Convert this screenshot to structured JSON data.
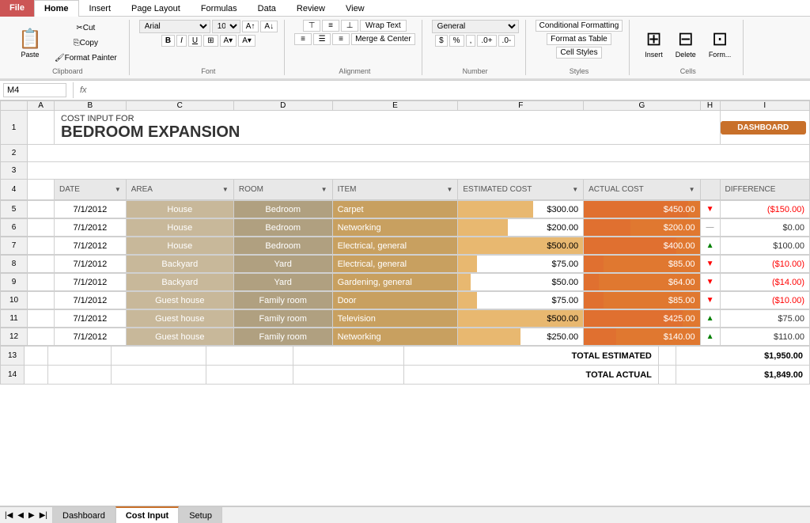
{
  "ribbon": {
    "file_label": "File",
    "tabs": [
      "Home",
      "Insert",
      "Page Layout",
      "Formulas",
      "Data",
      "Review",
      "View"
    ],
    "active_tab": "Home",
    "clipboard": {
      "paste_label": "Paste",
      "cut_label": "Cut",
      "copy_label": "Copy",
      "format_label": "Format Painter",
      "group_label": "Clipboard"
    },
    "font": {
      "name": "Arial",
      "size": "10",
      "group_label": "Font"
    },
    "alignment": {
      "wrap_text": "Wrap Text",
      "merge_center": "Merge & Center",
      "group_label": "Alignment"
    },
    "number": {
      "format": "General",
      "dollar": "$",
      "percent": "%",
      "comma": ",",
      "group_label": "Number"
    },
    "styles": {
      "conditional": "Conditional Formatting",
      "format_table": "Format as Table",
      "cell_styles": "Cell Styles",
      "group_label": "Styles"
    },
    "cells": {
      "insert": "Insert",
      "delete": "Delete",
      "format": "Form...",
      "group_label": "Cells"
    }
  },
  "formula_bar": {
    "name_box": "M4",
    "fx": "fx",
    "content": ""
  },
  "spreadsheet": {
    "col_headers": [
      "A",
      "B",
      "C",
      "D",
      "E",
      "F",
      "G",
      "H",
      "I"
    ],
    "row_headers": [
      "1",
      "2",
      "3",
      "4",
      "5",
      "6",
      "7",
      "8",
      "9",
      "10",
      "11",
      "12",
      "13",
      "14"
    ],
    "title_line1": "COST INPUT FOR",
    "title_line2": "BEDROOM EXPANSION",
    "dashboard_btn": "DASHBOARD",
    "col_headers_data": {
      "date": "DATE",
      "area": "AREA",
      "room": "ROOM",
      "item": "ITEM",
      "estimated_cost": "ESTIMATED COST",
      "actual_cost": "ACTUAL COST",
      "difference": "DIFFERENCE"
    },
    "rows": [
      {
        "date": "7/1/2012",
        "area": "House",
        "room": "Bedroom",
        "item": "Carpet",
        "estimated_cost": "$300.00",
        "est_pct": 60,
        "actual_cost": "$450.00",
        "actual_pct": 90,
        "arrow": "down",
        "difference": "($150.00)",
        "diff_type": "negative"
      },
      {
        "date": "7/1/2012",
        "area": "House",
        "room": "Bedroom",
        "item": "Networking",
        "estimated_cost": "$200.00",
        "est_pct": 40,
        "actual_cost": "$200.00",
        "actual_pct": 40,
        "arrow": "eq",
        "difference": "$0.00",
        "diff_type": "positive"
      },
      {
        "date": "7/1/2012",
        "area": "House",
        "room": "Bedroom",
        "item": "Electrical, general",
        "estimated_cost": "$500.00",
        "est_pct": 100,
        "actual_cost": "$400.00",
        "actual_pct": 80,
        "arrow": "up",
        "difference": "$100.00",
        "diff_type": "positive"
      },
      {
        "date": "7/1/2012",
        "area": "Backyard",
        "room": "Yard",
        "item": "Electrical, general",
        "estimated_cost": "$75.00",
        "est_pct": 15,
        "actual_cost": "$85.00",
        "actual_pct": 17,
        "arrow": "down",
        "difference": "($10.00)",
        "diff_type": "negative"
      },
      {
        "date": "7/1/2012",
        "area": "Backyard",
        "room": "Yard",
        "item": "Gardening, general",
        "estimated_cost": "$50.00",
        "est_pct": 10,
        "actual_cost": "$64.00",
        "actual_pct": 13,
        "arrow": "down",
        "difference": "($14.00)",
        "diff_type": "negative"
      },
      {
        "date": "7/1/2012",
        "area": "Guest house",
        "room": "Family room",
        "item": "Door",
        "estimated_cost": "$75.00",
        "est_pct": 15,
        "actual_cost": "$85.00",
        "actual_pct": 17,
        "arrow": "down",
        "difference": "($10.00)",
        "diff_type": "negative"
      },
      {
        "date": "7/1/2012",
        "area": "Guest house",
        "room": "Family room",
        "item": "Television",
        "estimated_cost": "$500.00",
        "est_pct": 100,
        "actual_cost": "$425.00",
        "actual_pct": 85,
        "arrow": "up",
        "difference": "$75.00",
        "diff_type": "positive"
      },
      {
        "date": "7/1/2012",
        "area": "Guest house",
        "room": "Family room",
        "item": "Networking",
        "estimated_cost": "$250.00",
        "est_pct": 50,
        "actual_cost": "$140.00",
        "actual_pct": 28,
        "arrow": "up",
        "difference": "$110.00",
        "diff_type": "positive"
      }
    ],
    "total_estimated_label": "TOTAL ESTIMATED",
    "total_estimated_value": "$1,950.00",
    "total_actual_label": "TOTAL ACTUAL",
    "total_actual_value": "$1,849.00"
  },
  "bottom_tabs": {
    "tabs": [
      "Dashboard",
      "Cost Input",
      "Setup"
    ],
    "active": "Cost Input"
  }
}
